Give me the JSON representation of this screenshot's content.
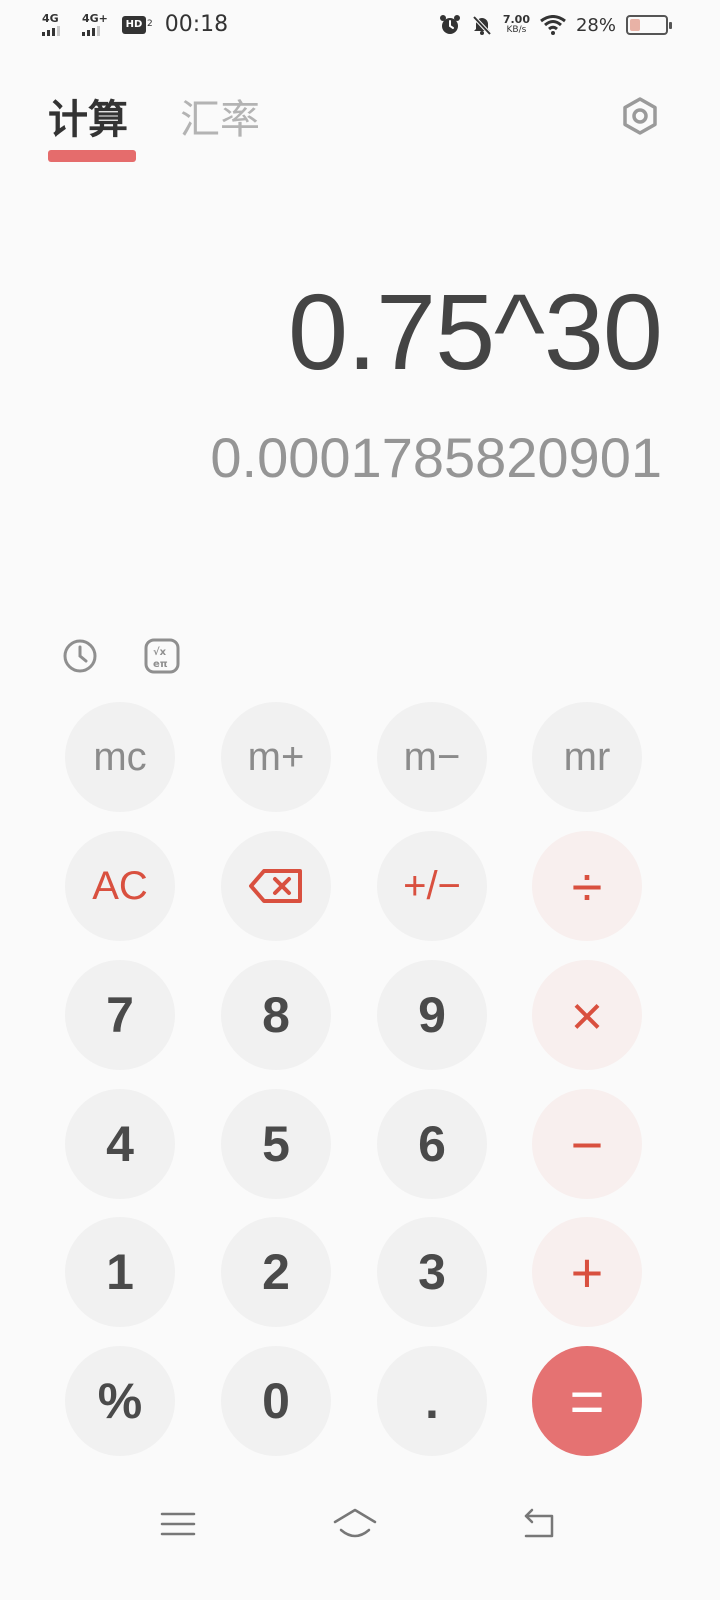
{
  "status_bar": {
    "sim1_type": "4G",
    "sim2_type": "4G+",
    "hd_label": "HD",
    "hd_sub": "2",
    "time": "00:18",
    "net_speed_value": "7.00",
    "net_speed_unit": "KB/s",
    "battery_percent": "28%",
    "battery_level": 0.28
  },
  "tabs": [
    {
      "label": "计算",
      "active": true
    },
    {
      "label": "汇率",
      "active": false
    }
  ],
  "display": {
    "expression": "0.75^30",
    "result": "0.0001785820901"
  },
  "keys": {
    "mc": "mc",
    "m_plus": "m+",
    "m_minus": "m−",
    "mr": "mr",
    "ac": "AC",
    "plus_minus": "+/−",
    "divide": "÷",
    "seven": "7",
    "eight": "8",
    "nine": "9",
    "multiply": "×",
    "four": "4",
    "five": "5",
    "six": "6",
    "minus": "−",
    "one": "1",
    "two": "2",
    "three": "3",
    "plus": "+",
    "percent": "%",
    "zero": "0",
    "dot": ".",
    "equals": "="
  },
  "icons": {
    "settings": "settings-gear-icon",
    "history": "history-clock-icon",
    "scientific": "scientific-functions-icon",
    "backspace": "backspace-icon",
    "nav_menu": "menu-icon",
    "nav_home": "home-icon",
    "nav_back": "back-icon"
  },
  "colors": {
    "accent": "#e56c6c",
    "operator_text": "#d9503f",
    "operator_bg": "#f8efee",
    "key_bg": "#f1f1f1",
    "background": "#fafafa"
  }
}
